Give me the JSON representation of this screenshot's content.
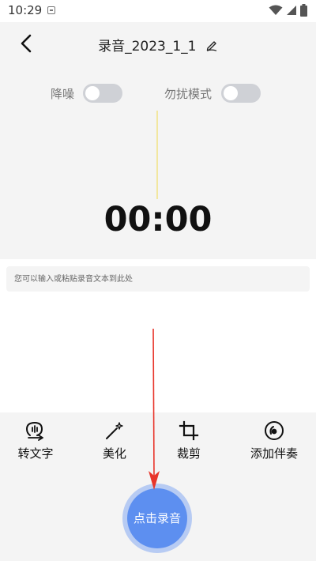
{
  "status_bar": {
    "time": "10:29"
  },
  "header": {
    "title": "录音_2023_1_1"
  },
  "toggles": [
    {
      "label": "降噪",
      "on": false
    },
    {
      "label": "勿扰模式",
      "on": false
    }
  ],
  "timer": "00:00",
  "text_input": {
    "placeholder": "您可以输入或粘贴录音文本到此处",
    "value": ""
  },
  "tools": [
    {
      "label": "转文字",
      "icon": "speech-to-text-icon"
    },
    {
      "label": "美化",
      "icon": "magic-wand-icon"
    },
    {
      "label": "裁剪",
      "icon": "crop-icon"
    },
    {
      "label": "添加伴奏",
      "icon": "music-disc-icon"
    }
  ],
  "record_button": {
    "label": "点击录音"
  },
  "colors": {
    "accent": "#5d8ff0",
    "halo": "#b7cbf3",
    "toggle_off": "#cfd1d6",
    "annotation_arrow": "#e8352b",
    "cursor_line": "#f2e7a0"
  }
}
